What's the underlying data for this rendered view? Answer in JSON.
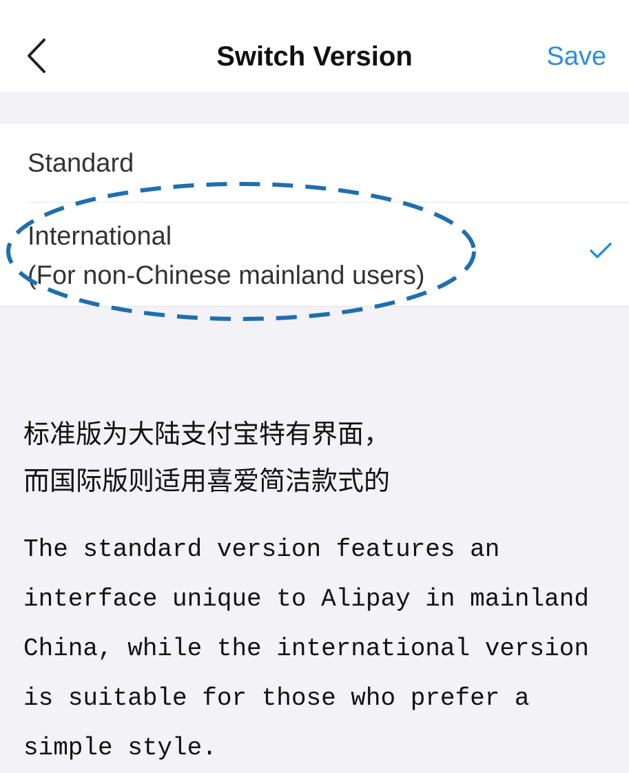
{
  "nav": {
    "title": "Switch Version",
    "save_label": "Save",
    "accent_color": "#2a8fd6"
  },
  "options": {
    "standard": {
      "label": "Standard",
      "selected": false
    },
    "international": {
      "label_line1": "International",
      "label_line2": "(For non-Chinese mainland users)",
      "selected": true
    }
  },
  "annotation": {
    "shape": "dashed-ellipse",
    "color": "#1f6fae"
  },
  "description": {
    "chinese": "标准版为大陆支付宝特有界面，\n而国际版则适用喜爱简洁款式的",
    "english": "The standard version features an\ninterface unique to Alipay in mainland\nChina, while the international version\nis suitable for those who prefer a\nsimple style."
  }
}
